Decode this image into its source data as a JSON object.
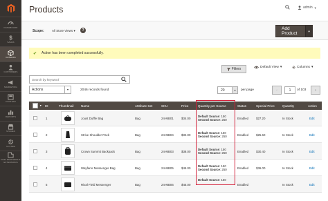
{
  "sidebar": {
    "items": [
      {
        "label": "DASHBOARD",
        "icon": "dashboard-icon"
      },
      {
        "label": "SALES",
        "icon": "dollar-icon"
      },
      {
        "label": "CATALOG",
        "icon": "catalog-box-icon",
        "active": true
      },
      {
        "label": "CUSTOMERS",
        "icon": "customers-icon"
      },
      {
        "label": "MARKETING",
        "icon": "megaphone-icon"
      },
      {
        "label": "CONTENT",
        "icon": "content-icon"
      },
      {
        "label": "REPORTS",
        "icon": "bar-chart-icon"
      },
      {
        "label": "STORES",
        "icon": "store-icon"
      },
      {
        "label": "SYSTEM",
        "icon": "gear-icon"
      },
      {
        "label": "FIND PARTNERS & EXTENSIONS",
        "icon": "extensions-icon"
      }
    ]
  },
  "header": {
    "title": "Products",
    "user": "admin"
  },
  "scope": {
    "label": "Scope:",
    "value": "All Store Views",
    "help": "?"
  },
  "toolbar": {
    "add_product": "Add Product"
  },
  "message": {
    "text": "Action has been completed successfully."
  },
  "controls": {
    "filters": "Filters",
    "view": "Default View",
    "columns": "Columns",
    "search_placeholder": "Search by keyword",
    "actions": "Actions",
    "records": "2046 records found",
    "per_page_value": "20",
    "per_page_label": "per page",
    "page": "1",
    "of_pages": "of 103"
  },
  "grid": {
    "columns": [
      "ID",
      "Thumbnail",
      "Name",
      "Attribute Set",
      "SKU",
      "Price",
      "Quantity per Source",
      "Status",
      "Special Price",
      "Quantity",
      "Action"
    ],
    "rows": [
      {
        "id": "1",
        "name": "Joust Duffle Bag",
        "attr": "Bag",
        "sku": "24-MB01",
        "price": "$34.00",
        "src1": "Default Source",
        "q1": "150",
        "src2": "Second Source",
        "q2": "250",
        "status": "Enabled",
        "special": "$27.20",
        "qty": "In Stock",
        "action": "Edit",
        "thumb": "duffle"
      },
      {
        "id": "2",
        "name": "Strive Shoulder Pack",
        "attr": "Bag",
        "sku": "24-MB04",
        "price": "$32.00",
        "src1": "Default Source",
        "q1": "150",
        "src2": "Second Source",
        "q2": "250",
        "status": "Enabled",
        "special": "$25.60",
        "qty": "In Stock",
        "action": "Edit",
        "thumb": "shoulder"
      },
      {
        "id": "3",
        "name": "Crown Summit Backpack",
        "attr": "Bag",
        "sku": "24-MB03",
        "price": "$38.00",
        "src1": "Default Source",
        "q1": "150",
        "src2": "Second Source",
        "q2": "250",
        "status": "Enabled",
        "special": "$30.40",
        "qty": "In Stock",
        "action": "Edit",
        "thumb": "backpack"
      },
      {
        "id": "4",
        "name": "Wayfarer Messenger Bag",
        "attr": "Bag",
        "sku": "24-MB05",
        "price": "$45.00",
        "src1": "Default Source",
        "q1": "150",
        "src2": "Second Source",
        "q2": "250",
        "status": "Enabled",
        "special": "$36.00",
        "qty": "In Stock",
        "action": "Edit",
        "thumb": "messenger"
      },
      {
        "id": "5",
        "name": "Rival Field Messenger",
        "attr": "Bag",
        "sku": "24-MB06",
        "price": "$45.00",
        "src1": "Default Source",
        "q1": "150",
        "src2": "",
        "q2": "",
        "status": "Enabled",
        "special": "",
        "qty": "In Stock",
        "action": "Edit",
        "thumb": "field"
      }
    ]
  },
  "colors": {
    "sidebar_bg": "#373330",
    "grid_header_bg": "#514943",
    "highlight": "#d3213a",
    "message_bg": "#fffbbb",
    "link": "#006bb4"
  }
}
